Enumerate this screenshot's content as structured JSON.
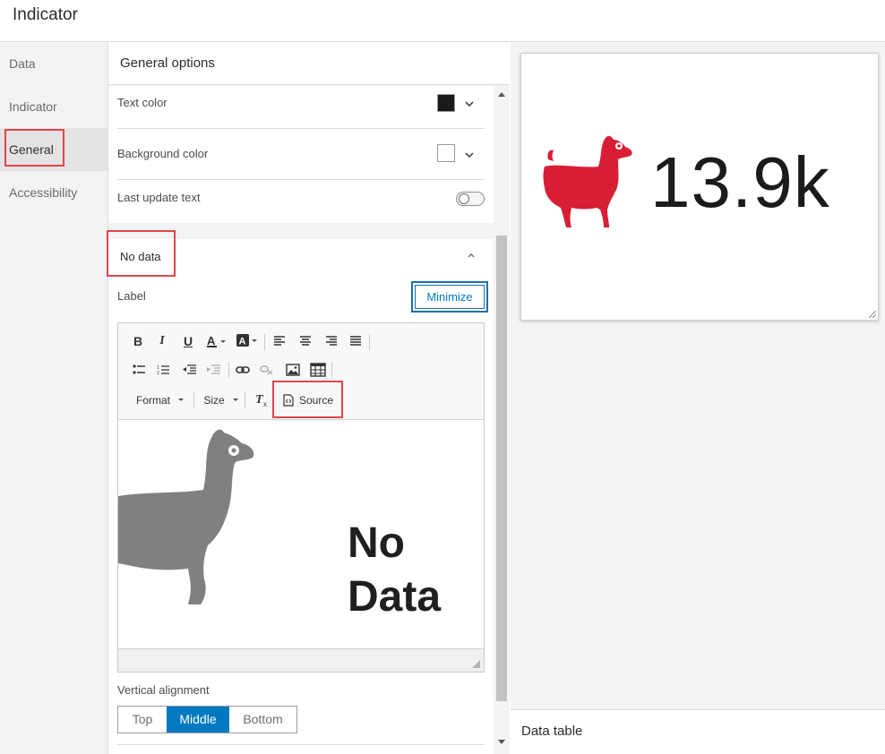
{
  "app": {
    "title": "Indicator"
  },
  "sidebar": {
    "items": [
      {
        "label": "Data"
      },
      {
        "label": "Indicator"
      },
      {
        "label": "General"
      },
      {
        "label": "Accessibility"
      }
    ]
  },
  "panel": {
    "header": "General options",
    "text_color_label": "Text color",
    "text_color_value": "#1a1a1a",
    "background_color_label": "Background color",
    "background_color_value": "#ffffff",
    "last_update_label": "Last update text",
    "no_data_title": "No data",
    "label_caption": "Label",
    "minimize_label": "Minimize",
    "editor": {
      "bold": "B",
      "italic": "I",
      "underline": "U",
      "format_label": "Format",
      "size_label": "Size",
      "source_label": "Source",
      "content_line1": "No",
      "content_line2": "Data"
    },
    "vertical_alignment_label": "Vertical alignment",
    "vertical_alignment_options": [
      "Top",
      "Middle",
      "Bottom"
    ],
    "vertical_alignment_selected": "Middle"
  },
  "preview": {
    "value": "13.9k",
    "icon_color": "#d81e35",
    "data_table_label": "Data table"
  },
  "colors": {
    "accent": "#0079c1",
    "highlight_box": "#e0454a"
  }
}
